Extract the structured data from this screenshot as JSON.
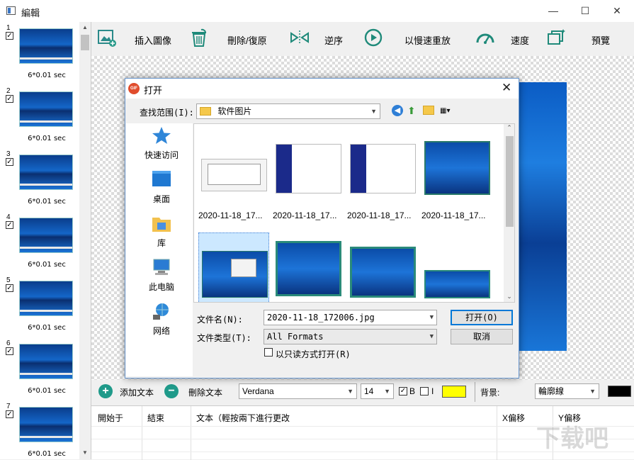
{
  "window": {
    "title": "編輯",
    "controls": {
      "minimize": "—",
      "maximize": "☐",
      "close": "✕"
    }
  },
  "frames": [
    {
      "num": "1",
      "duration": "6*0.01 sec"
    },
    {
      "num": "2",
      "duration": "6*0.01 sec"
    },
    {
      "num": "3",
      "duration": "6*0.01 sec"
    },
    {
      "num": "4",
      "duration": "6*0.01 sec"
    },
    {
      "num": "5",
      "duration": "6*0.01 sec"
    },
    {
      "num": "6",
      "duration": "6*0.01 sec"
    },
    {
      "num": "7",
      "duration": "6*0.01 sec"
    }
  ],
  "toolbar": {
    "insert": "插入圖像",
    "delete_restore": "刪除/復原",
    "reverse": "逆序",
    "slow_replay": "以慢速重放",
    "speed": "速度",
    "preview": "預覽"
  },
  "textbar": {
    "add_text": "添加文本",
    "delete_text": "刪除文本",
    "font": "Verdana",
    "size": "14",
    "bold_label": "B",
    "italic_label": "I",
    "background_label": "背景:",
    "outline": "輪廓線",
    "text_color": "#ffff00",
    "outline_color": "#000000"
  },
  "table": {
    "columns": [
      "開始于",
      "結束",
      "文本（輕按兩下進行更改",
      "X偏移",
      "Y偏移"
    ]
  },
  "dialog": {
    "title": "打开",
    "icon_text": "GIF",
    "lookin_label": "查找范围(I):",
    "lookin_value": "软件图片",
    "places": [
      "快速访问",
      "桌面",
      "库",
      "此电脑",
      "网络"
    ],
    "files": [
      {
        "name": "2020-11-18_17..."
      },
      {
        "name": "2020-11-18_17..."
      },
      {
        "name": "2020-11-18_17..."
      },
      {
        "name": "2020-11-18_17..."
      },
      {
        "name": ""
      },
      {
        "name": ""
      },
      {
        "name": ""
      },
      {
        "name": ""
      }
    ],
    "filename_label": "文件名(N):",
    "filename_value": "2020-11-18_172006.jpg",
    "filetype_label": "文件类型(T):",
    "filetype_value": "All Formats",
    "readonly_label": "以只读方式打开(R)",
    "open_button": "打开(O)",
    "cancel_button": "取消"
  },
  "watermark": "下载吧"
}
